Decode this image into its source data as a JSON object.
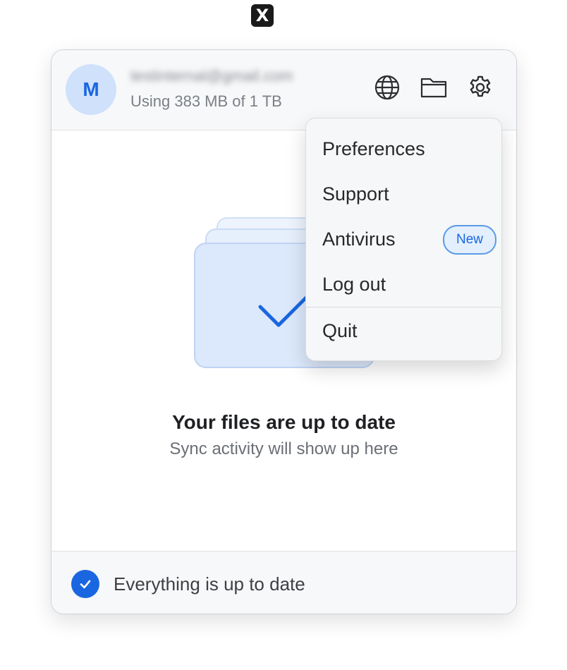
{
  "menubar": {
    "app_icon_glyph": "X"
  },
  "account": {
    "avatar_initial": "M",
    "email": "testinternal@gmail.com",
    "usage": "Using 383 MB of 1 TB"
  },
  "header_icons": [
    "globe-icon",
    "folder-icon",
    "gear-icon"
  ],
  "empty_state": {
    "title": "Your files are up to date",
    "subtitle": "Sync activity will show up here"
  },
  "footer": {
    "status_text": "Everything is up to date"
  },
  "menu": {
    "items": [
      {
        "label": "Preferences"
      },
      {
        "label": "Support"
      },
      {
        "label": "Antivirus",
        "badge": "New"
      },
      {
        "label": "Log out"
      },
      {
        "label": "Quit"
      }
    ]
  },
  "colors": {
    "accent": "#1a66e0",
    "avatar_bg": "#cfe1fb",
    "panel_bg": "#ffffff",
    "header_bg": "#f7f8f9",
    "menu_bg": "#f6f7f8"
  }
}
